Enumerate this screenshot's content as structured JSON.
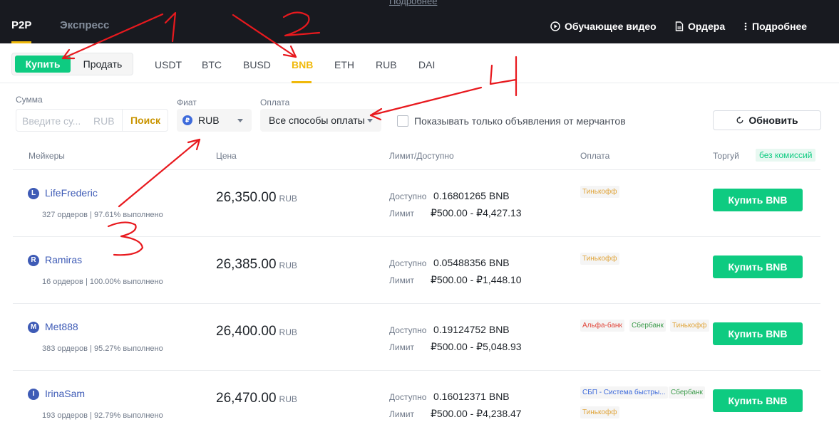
{
  "topnav": {
    "top_link": "Подробнее",
    "tabs": [
      "P2P",
      "Экспресс"
    ],
    "video_label": "Обучающее видео",
    "orders_label": "Ордера",
    "more_label": "Подробнее"
  },
  "trade": {
    "buy_label": "Купить",
    "sell_label": "Продать",
    "coins": [
      "USDT",
      "BTC",
      "BUSD",
      "BNB",
      "ETH",
      "RUB",
      "DAI"
    ],
    "active_coin": "BNB"
  },
  "filters": {
    "amount_label": "Сумма",
    "amount_placeholder": "Введите су...",
    "amount_currency": "RUB",
    "search_label": "Поиск",
    "fiat_label": "Фиат",
    "fiat_value": "RUB",
    "fiat_symbol": "₽",
    "payment_label": "Оплата",
    "payment_value": "Все способы оплаты",
    "merchant_only_label": "Показывать только объявления от мерчантов",
    "refresh_label": "Обновить"
  },
  "table": {
    "headers": {
      "makers": "Мейкеры",
      "price": "Цена",
      "limit": "Лимит/Доступно",
      "payment": "Оплата",
      "trade": "Торгуй",
      "no_fee": "без комиссий"
    },
    "available_label": "Доступно",
    "limit_label": "Лимит",
    "price_currency": "RUB",
    "buy_button_label": "Купить BNB",
    "rows": [
      {
        "initial": "L",
        "name": "LifeFrederic",
        "stats": "327 ордеров | 97.61% выполнено",
        "price": "26,350.00",
        "available": "0.16801265 BNB",
        "limit": "₽500.00 - ₽4,427.13",
        "payments": [
          {
            "label": "Тинькофф",
            "color": "#e0a43a"
          }
        ]
      },
      {
        "initial": "R",
        "name": "Ramiras",
        "stats": "16 ордеров | 100.00% выполнено",
        "price": "26,385.00",
        "available": "0.05488356 BNB",
        "limit": "₽500.00 - ₽1,448.10",
        "payments": [
          {
            "label": "Тинькофф",
            "color": "#e0a43a"
          }
        ]
      },
      {
        "initial": "M",
        "name": "Met888",
        "stats": "383 ордеров | 95.27% выполнено",
        "price": "26,400.00",
        "available": "0.19124752 BNB",
        "limit": "₽500.00 - ₽5,048.93",
        "payments": [
          {
            "label": "Альфа-банк",
            "color": "#e0463a"
          },
          {
            "label": "Сбербанк",
            "color": "#3b9b4a"
          },
          {
            "label": "Тинькофф",
            "color": "#e0a43a"
          }
        ]
      },
      {
        "initial": "I",
        "name": "IrinaSam",
        "stats": "193 ордеров | 92.79% выполнено",
        "price": "26,470.00",
        "available": "0.16012371 BNB",
        "limit": "₽500.00 - ₽4,238.47",
        "payments": [
          {
            "label": "СБП - Система быстры...",
            "color": "#3e6bdb"
          },
          {
            "label": "Сбербанк",
            "color": "#3b9b4a"
          },
          {
            "label": "Тинькофф",
            "color": "#e0a43a"
          }
        ]
      }
    ]
  },
  "colors": {
    "accent": "#f0b90b",
    "buy_green": "#0ecb81",
    "nav_bg": "#181a20",
    "annotation": "#e8191e"
  }
}
